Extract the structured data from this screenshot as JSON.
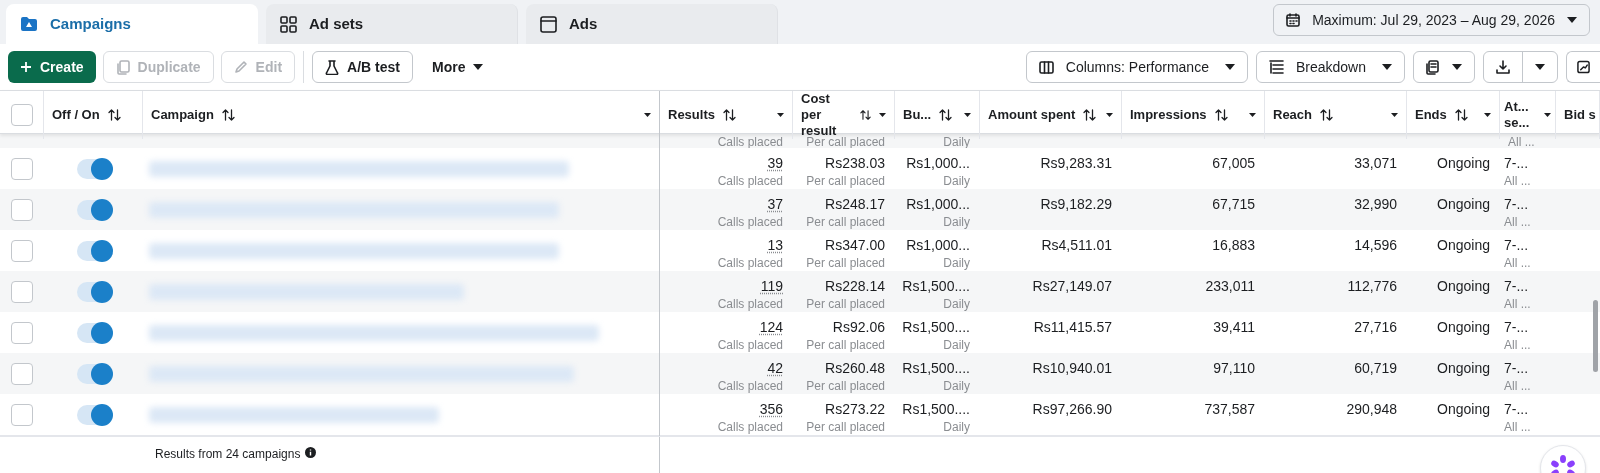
{
  "tabs": [
    {
      "label": "Campaigns",
      "selected": true
    },
    {
      "label": "Ad sets",
      "selected": false
    },
    {
      "label": "Ads",
      "selected": false
    }
  ],
  "date_range": {
    "label": "Maximum: Jul 29, 2023 – Aug 29, 2026"
  },
  "toolbar": {
    "left": [
      {
        "kind": "primary",
        "label": "Create",
        "disabled": false
      },
      {
        "kind": "plain",
        "label": "Duplicate",
        "disabled": true
      },
      {
        "kind": "plain",
        "label": "Edit",
        "disabled": true
      },
      {
        "kind": "plain",
        "label": "A/B test",
        "disabled": false
      },
      {
        "kind": "menu",
        "label": "More"
      }
    ],
    "right": [
      {
        "kind": "menu",
        "label": "Columns: Performance"
      },
      {
        "kind": "menu",
        "label": "Breakdown"
      },
      {
        "kind": "icon-menu"
      },
      {
        "kind": "split"
      },
      {
        "kind": "icon"
      }
    ]
  },
  "table": {
    "header_checked": false,
    "columns": [
      {
        "label": "Off / On"
      },
      {
        "label": "Campaign"
      },
      {
        "label": "Results"
      },
      {
        "label": "Cost per result"
      },
      {
        "label": "Bu..."
      },
      {
        "label": "Amount spent"
      },
      {
        "label": "Impressions"
      },
      {
        "label": "Reach"
      },
      {
        "label": "Ends"
      },
      {
        "label": "At... se..."
      },
      {
        "label": "Bid s"
      }
    ],
    "partial_row": {
      "results_sub": "Calls placed",
      "cost_sub": "Per call placed",
      "budget_sub": "Daily",
      "attribution_sub": "All ..."
    },
    "rows": [
      {
        "checked": false,
        "on": true,
        "results": "39",
        "results_sub": "Calls placed",
        "cost": "Rs238.03",
        "cost_sub": "Per call placed",
        "budget": "Rs1,000...",
        "budget_sub": "Daily",
        "amount": "Rs9,283.31",
        "impressions": "67,005",
        "reach": "33,071",
        "ends": "Ongoing",
        "attribution": "7-...",
        "attribution_sub": "All ..."
      },
      {
        "checked": false,
        "on": true,
        "results": "37",
        "results_sub": "Calls placed",
        "cost": "Rs248.17",
        "cost_sub": "Per call placed",
        "budget": "Rs1,000...",
        "budget_sub": "Daily",
        "amount": "Rs9,182.29",
        "impressions": "67,715",
        "reach": "32,990",
        "ends": "Ongoing",
        "attribution": "7-...",
        "attribution_sub": "All ..."
      },
      {
        "checked": false,
        "on": true,
        "results": "13",
        "results_sub": "Calls placed",
        "cost": "Rs347.00",
        "cost_sub": "Per call placed",
        "budget": "Rs1,000...",
        "budget_sub": "Daily",
        "amount": "Rs4,511.01",
        "impressions": "16,883",
        "reach": "14,596",
        "ends": "Ongoing",
        "attribution": "7-...",
        "attribution_sub": "All ..."
      },
      {
        "checked": false,
        "on": true,
        "results": "119",
        "results_sub": "Calls placed",
        "cost": "Rs228.14",
        "cost_sub": "Per call placed",
        "budget": "Rs1,500....",
        "budget_sub": "Daily",
        "amount": "Rs27,149.07",
        "impressions": "233,011",
        "reach": "112,776",
        "ends": "Ongoing",
        "attribution": "7-...",
        "attribution_sub": "All ..."
      },
      {
        "checked": false,
        "on": true,
        "results": "124",
        "results_sub": "Calls placed",
        "cost": "Rs92.06",
        "cost_sub": "Per call placed",
        "budget": "Rs1,500....",
        "budget_sub": "Daily",
        "amount": "Rs11,415.57",
        "impressions": "39,411",
        "reach": "27,716",
        "ends": "Ongoing",
        "attribution": "7-...",
        "attribution_sub": "All ..."
      },
      {
        "checked": false,
        "on": true,
        "results": "42",
        "results_sub": "Calls placed",
        "cost": "Rs260.48",
        "cost_sub": "Per call placed",
        "budget": "Rs1,500....",
        "budget_sub": "Daily",
        "amount": "Rs10,940.01",
        "impressions": "97,110",
        "reach": "60,719",
        "ends": "Ongoing",
        "attribution": "7-...",
        "attribution_sub": "All ..."
      },
      {
        "checked": false,
        "on": true,
        "results": "356",
        "results_sub": "Calls placed",
        "cost": "Rs273.22",
        "cost_sub": "Per call placed",
        "budget": "Rs1,500....",
        "budget_sub": "Daily",
        "amount": "Rs97,266.90",
        "impressions": "737,587",
        "reach": "290,948",
        "ends": "Ongoing",
        "attribution": "7-...",
        "attribution_sub": "All ..."
      }
    ],
    "footer": "Results from 24 campaigns"
  }
}
